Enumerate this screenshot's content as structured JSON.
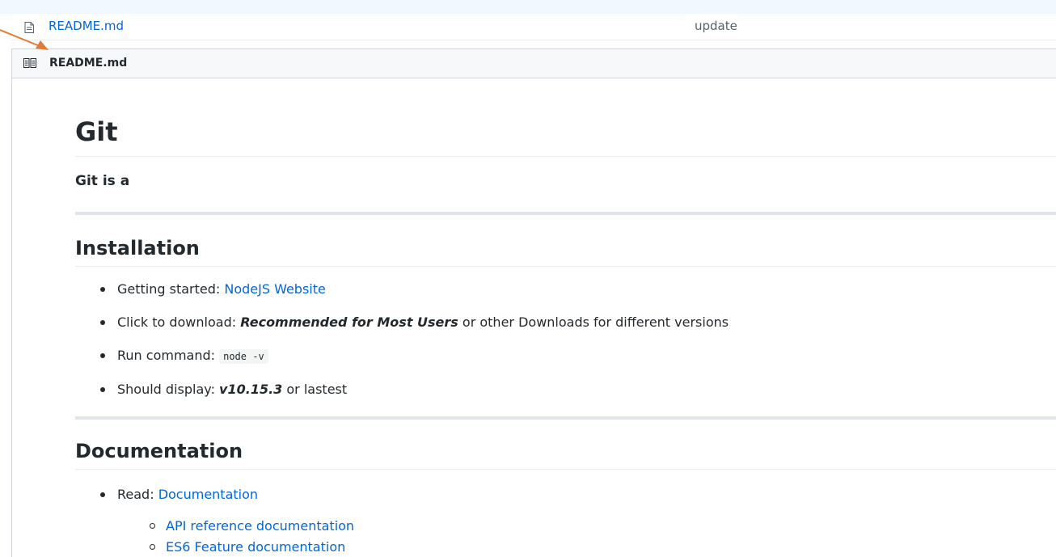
{
  "file_row": {
    "name": "README.md",
    "commit": "update"
  },
  "readme": {
    "header": "README.md",
    "h1": "Git",
    "lead": "Git is a",
    "installation": {
      "heading": "Installation",
      "items": [
        {
          "prefix": "Getting started: ",
          "link": "NodeJS Website"
        },
        {
          "prefix": "Click to download: ",
          "em": "Recommended for Most Users",
          "suffix": " or other Downloads for different versions"
        },
        {
          "prefix": "Run command: ",
          "code": "node -v"
        },
        {
          "prefix": "Should display: ",
          "em": "v10.15.3",
          "suffix": " or lastest"
        }
      ]
    },
    "documentation": {
      "heading": "Documentation",
      "read_prefix": "Read: ",
      "read_link": "Documentation",
      "sub_items": [
        "API reference documentation",
        "ES6 Feature documentation"
      ]
    }
  },
  "colors": {
    "link": "#0366d6",
    "annotation_arrow": "#e07b39"
  },
  "icons": {
    "file": "file-text-icon",
    "book": "book-icon",
    "annotation": "arrow-annotation-icon"
  }
}
